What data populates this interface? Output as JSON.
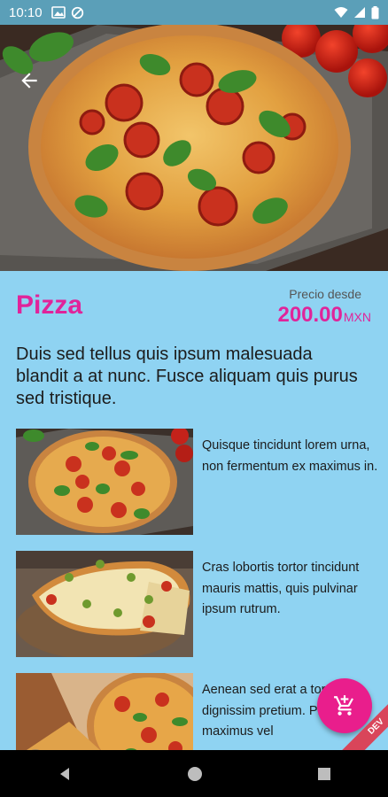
{
  "status_bar": {
    "time": "10:10"
  },
  "product": {
    "title": "Pizza",
    "price_label": "Precio desde",
    "price": "200.00",
    "currency": "MXN",
    "description": "Duis sed tellus quis ipsum malesuada blandit a at nunc. Fusce aliquam quis purus sed tristique."
  },
  "items": [
    {
      "text": "Quisque tincidunt lorem urna, non fermentum ex maximus in."
    },
    {
      "text": "Cras lobortis tortor tincidunt mauris mattis, quis pulvinar ipsum rutrum."
    },
    {
      "text": "Aenean sed erat a tortor dignissim pretium. Praesent maximus vel"
    }
  ],
  "fab": {
    "icon": "add-to-cart-icon"
  },
  "debug_banner": "DEV",
  "colors": {
    "accent": "#e0249a",
    "background": "#8fd3f2",
    "fab": "#e91e8c",
    "status_bar": "#5b9fb8"
  }
}
